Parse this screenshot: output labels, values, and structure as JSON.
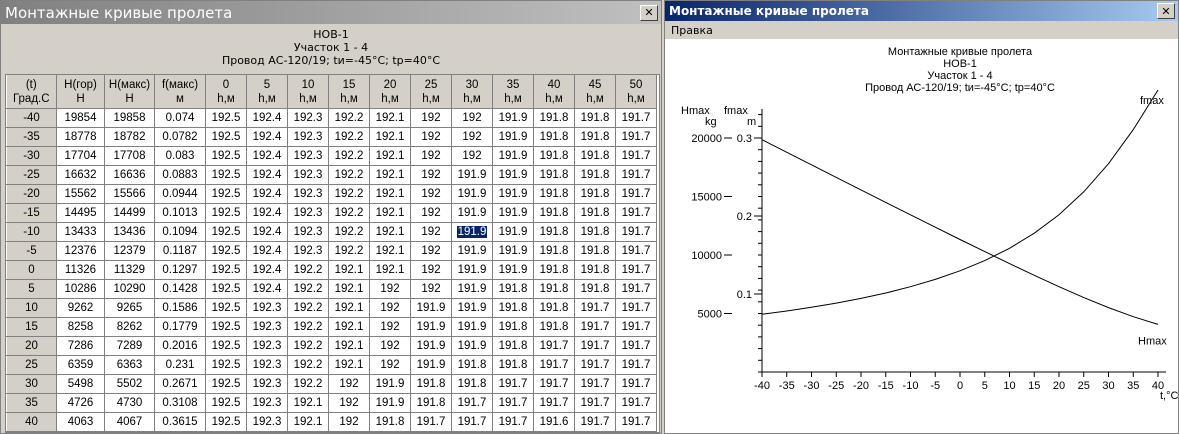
{
  "left_window": {
    "title": "Монтажные кривые пролета",
    "close_glyph": "✕",
    "header": {
      "line1": "НОВ-1",
      "line2": "Участок 1 - 4",
      "line3": "Провод АС-120/19; tи=-45°С; tр=40°С"
    },
    "table": {
      "columns": [
        [
          "(t)",
          "Град.С"
        ],
        [
          "H(гор)",
          "Н"
        ],
        [
          "H(макс)",
          "Н"
        ],
        [
          "f(макс)",
          "м"
        ],
        [
          "0",
          "h,м"
        ],
        [
          "5",
          "h,м"
        ],
        [
          "10",
          "h,м"
        ],
        [
          "15",
          "h,м"
        ],
        [
          "20",
          "h,м"
        ],
        [
          "25",
          "h,м"
        ],
        [
          "30",
          "h,м"
        ],
        [
          "35",
          "h,м"
        ],
        [
          "40",
          "h,м"
        ],
        [
          "45",
          "h,м"
        ],
        [
          "50",
          "h,м"
        ]
      ],
      "rows": [
        [
          "-40",
          "19854",
          "19858",
          "0.074",
          "192.5",
          "192.4",
          "192.3",
          "192.2",
          "192.1",
          "192",
          "192",
          "191.9",
          "191.8",
          "191.8",
          "191.7"
        ],
        [
          "-35",
          "18778",
          "18782",
          "0.0782",
          "192.5",
          "192.4",
          "192.3",
          "192.2",
          "192.1",
          "192",
          "192",
          "191.9",
          "191.8",
          "191.8",
          "191.7"
        ],
        [
          "-30",
          "17704",
          "17708",
          "0.083",
          "192.5",
          "192.4",
          "192.3",
          "192.2",
          "192.1",
          "192",
          "192",
          "191.9",
          "191.8",
          "191.8",
          "191.7"
        ],
        [
          "-25",
          "16632",
          "16636",
          "0.0883",
          "192.5",
          "192.4",
          "192.3",
          "192.2",
          "192.1",
          "192",
          "191.9",
          "191.9",
          "191.8",
          "191.8",
          "191.7"
        ],
        [
          "-20",
          "15562",
          "15566",
          "0.0944",
          "192.5",
          "192.4",
          "192.3",
          "192.2",
          "192.1",
          "192",
          "191.9",
          "191.9",
          "191.8",
          "191.8",
          "191.7"
        ],
        [
          "-15",
          "14495",
          "14499",
          "0.1013",
          "192.5",
          "192.4",
          "192.3",
          "192.2",
          "192.1",
          "192",
          "191.9",
          "191.9",
          "191.8",
          "191.8",
          "191.7"
        ],
        [
          "-10",
          "13433",
          "13436",
          "0.1094",
          "192.5",
          "192.4",
          "192.3",
          "192.2",
          "192.1",
          "192",
          "191.9",
          "191.9",
          "191.8",
          "191.8",
          "191.7"
        ],
        [
          "-5",
          "12376",
          "12379",
          "0.1187",
          "192.5",
          "192.4",
          "192.3",
          "192.2",
          "192.1",
          "192",
          "191.9",
          "191.9",
          "191.8",
          "191.8",
          "191.7"
        ],
        [
          "0",
          "11326",
          "11329",
          "0.1297",
          "192.5",
          "192.4",
          "192.2",
          "192.1",
          "192.1",
          "192",
          "191.9",
          "191.9",
          "191.8",
          "191.8",
          "191.7"
        ],
        [
          "5",
          "10286",
          "10290",
          "0.1428",
          "192.5",
          "192.4",
          "192.2",
          "192.1",
          "192",
          "192",
          "191.9",
          "191.8",
          "191.8",
          "191.8",
          "191.7"
        ],
        [
          "10",
          "9262",
          "9265",
          "0.1586",
          "192.5",
          "192.3",
          "192.2",
          "192.1",
          "192",
          "191.9",
          "191.9",
          "191.8",
          "191.8",
          "191.7",
          "191.7"
        ],
        [
          "15",
          "8258",
          "8262",
          "0.1779",
          "192.5",
          "192.3",
          "192.2",
          "192.1",
          "192",
          "191.9",
          "191.9",
          "191.8",
          "191.8",
          "191.7",
          "191.7"
        ],
        [
          "20",
          "7286",
          "7289",
          "0.2016",
          "192.5",
          "192.3",
          "192.2",
          "192.1",
          "192",
          "191.9",
          "191.9",
          "191.8",
          "191.7",
          "191.7",
          "191.7"
        ],
        [
          "25",
          "6359",
          "6363",
          "0.231",
          "192.5",
          "192.3",
          "192.2",
          "192.1",
          "192",
          "191.9",
          "191.8",
          "191.8",
          "191.7",
          "191.7",
          "191.7"
        ],
        [
          "30",
          "5498",
          "5502",
          "0.2671",
          "192.5",
          "192.3",
          "192.2",
          "192",
          "191.9",
          "191.8",
          "191.8",
          "191.7",
          "191.7",
          "191.7",
          "191.7"
        ],
        [
          "35",
          "4726",
          "4730",
          "0.3108",
          "192.5",
          "192.3",
          "192.1",
          "192",
          "191.9",
          "191.8",
          "191.7",
          "191.7",
          "191.7",
          "191.7",
          "191.7"
        ],
        [
          "40",
          "4063",
          "4067",
          "0.3615",
          "192.5",
          "192.3",
          "192.1",
          "192",
          "191.8",
          "191.7",
          "191.7",
          "191.7",
          "191.6",
          "191.7",
          "191.7"
        ]
      ],
      "selected_cell": {
        "row": 6,
        "col": 10
      }
    }
  },
  "right_window": {
    "title": "Монтажные кривые пролета",
    "close_glyph": "✕",
    "menu": [
      "Правка"
    ]
  },
  "chart_data": {
    "type": "line",
    "title_lines": [
      "Монтажные кривые пролета",
      "НОВ-1",
      "Участок 1 - 4",
      "Провод АС-120/19; tи=-45°С; tр=40°С"
    ],
    "xlabel": "t,°C",
    "xlim": [
      -40,
      40
    ],
    "x_ticks": [
      -40,
      -35,
      -30,
      -25,
      -20,
      -15,
      -10,
      -5,
      0,
      5,
      10,
      15,
      20,
      25,
      30,
      35,
      40
    ],
    "y_left": {
      "label": "Hmax",
      "unit": "kg",
      "ticks": [
        5000,
        10000,
        15000,
        20000
      ],
      "lim": [
        0,
        22000
      ]
    },
    "y_right": {
      "label": "fmax",
      "unit": "m",
      "ticks": [
        0.1,
        0.2,
        0.3
      ],
      "lim": [
        0.0,
        0.36
      ]
    },
    "series": [
      {
        "name": "Hmax",
        "axis": "left",
        "x": [
          -40,
          -35,
          -30,
          -25,
          -20,
          -15,
          -10,
          -5,
          0,
          5,
          10,
          15,
          20,
          25,
          30,
          35,
          40
        ],
        "values": [
          19858,
          18782,
          17708,
          16636,
          15566,
          14499,
          13436,
          12379,
          11329,
          10290,
          9265,
          8262,
          7289,
          6363,
          5502,
          4730,
          4067
        ]
      },
      {
        "name": "fmax",
        "axis": "right",
        "x": [
          -40,
          -35,
          -30,
          -25,
          -20,
          -15,
          -10,
          -5,
          0,
          5,
          10,
          15,
          20,
          25,
          30,
          35,
          40
        ],
        "values": [
          0.074,
          0.0782,
          0.083,
          0.0883,
          0.0944,
          0.1013,
          0.1094,
          0.1187,
          0.1297,
          0.1428,
          0.1586,
          0.1779,
          0.2016,
          0.231,
          0.2671,
          0.3108,
          0.3615
        ]
      }
    ]
  }
}
